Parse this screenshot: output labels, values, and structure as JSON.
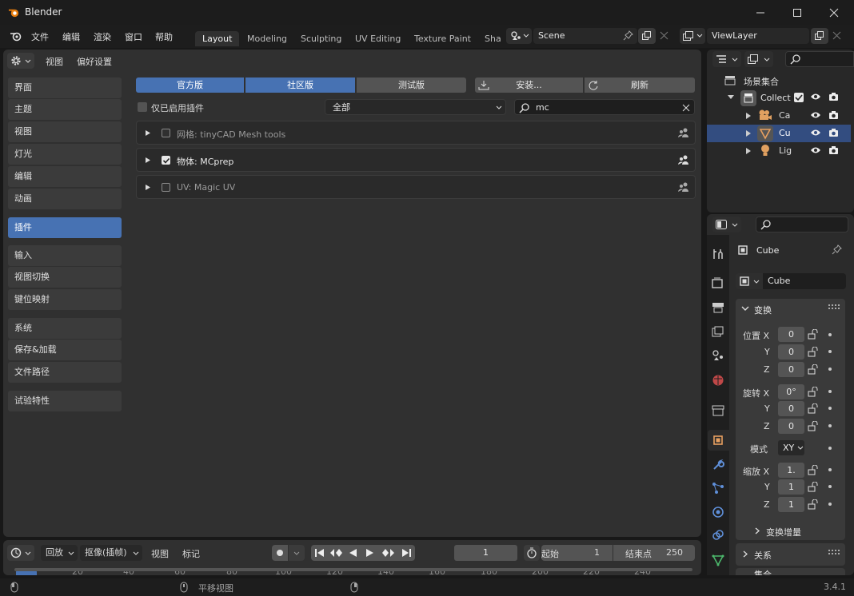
{
  "window": {
    "title": "Blender"
  },
  "menu": [
    "文件",
    "编辑",
    "渲染",
    "窗口",
    "帮助"
  ],
  "workspaces": [
    "Layout",
    "Modeling",
    "Sculpting",
    "UV Editing",
    "Texture Paint",
    "Sha"
  ],
  "scene": {
    "name": "Scene"
  },
  "viewlayer": {
    "name": "ViewLayer"
  },
  "prefs": {
    "header_menu": [
      "视图",
      "偏好设置"
    ],
    "nav": [
      "界面",
      "主题",
      "视图",
      "灯光",
      "编辑",
      "动画",
      "插件",
      "输入",
      "视图切换",
      "键位映射",
      "系统",
      "保存&加载",
      "文件路径",
      "试验特性"
    ],
    "tabs": [
      "官方版",
      "社区版",
      "测试版"
    ],
    "install_label": "安装...",
    "refresh_label": "刷新",
    "enabled_only_label": "仅已启用插件",
    "category_value": "全部",
    "search_value": "mc",
    "addons": [
      {
        "label": "网格: tinyCAD Mesh tools",
        "enabled": false
      },
      {
        "label": "物体: MCprep",
        "enabled": true
      },
      {
        "label": "UV: Magic UV",
        "enabled": false
      }
    ]
  },
  "outliner": {
    "root": "场景集合",
    "collection": "Collect",
    "items": [
      "Ca",
      "Cu",
      "Lig"
    ]
  },
  "properties": {
    "object_name": "Cube",
    "mesh_name": "Cube",
    "transform_label": "变换",
    "location_label": "位置 X",
    "rotation_label": "旋转 X",
    "scale_label": "缩放 X",
    "axis_y": "Y",
    "axis_z": "Z",
    "location": [
      "0",
      "0",
      "0"
    ],
    "rotation": [
      "0°",
      "0",
      "0"
    ],
    "scale": [
      "1.",
      "1",
      "1"
    ],
    "mode_label": "模式",
    "mode_value": "XY",
    "delta_label": "变换增量",
    "relations_label": "关系",
    "collections_label": "集合"
  },
  "timeline": {
    "playback": "回放",
    "keying": "抠像(插帧)",
    "view": "视图",
    "marker": "标记",
    "current_frame": "1",
    "start_label": "起始",
    "start_value": "1",
    "end_label": "结束点",
    "end_value": "250",
    "ruler": [
      "20",
      "40",
      "60",
      "80",
      "100",
      "120",
      "140",
      "160",
      "180",
      "200",
      "220",
      "240"
    ]
  },
  "status": {
    "pan": "平移视图",
    "version": "3.4.1"
  },
  "colors": {
    "accent": "#4772b3",
    "panel": "#303030",
    "background": "#181818"
  }
}
